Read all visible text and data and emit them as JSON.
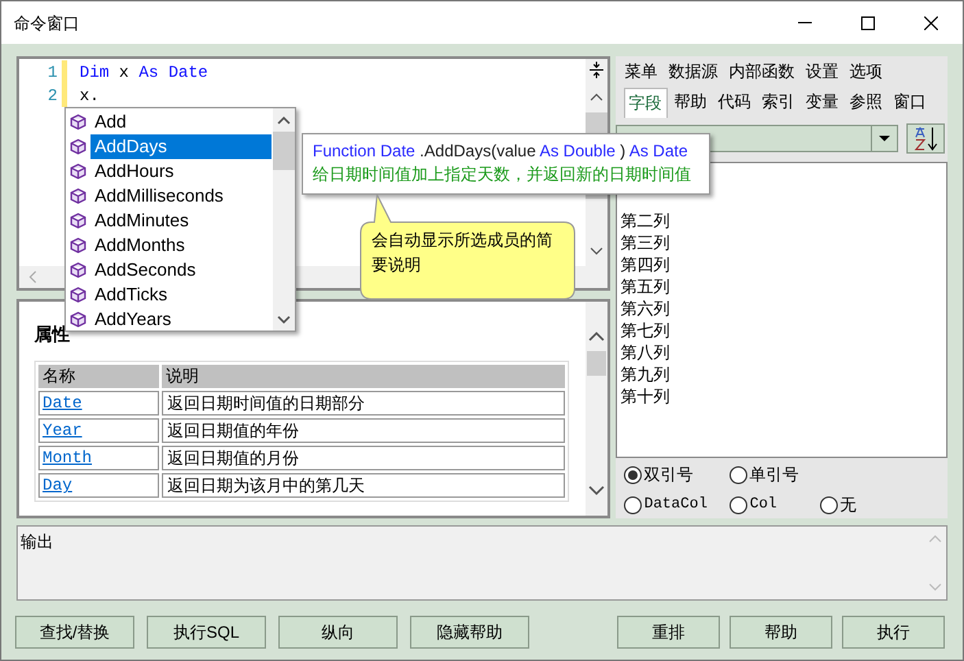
{
  "window": {
    "title": "命令窗口"
  },
  "editor": {
    "lines": [
      {
        "number": "1",
        "tokens": [
          {
            "text": "Dim",
            "kind": "keyword"
          },
          {
            "text": "x",
            "kind": "plain"
          },
          {
            "text": "As",
            "kind": "keyword"
          },
          {
            "text": "Date",
            "kind": "keyword"
          }
        ]
      },
      {
        "number": "2",
        "tokens": [
          {
            "text": "x.",
            "kind": "plain"
          }
        ]
      }
    ]
  },
  "autocomplete": {
    "items": [
      {
        "label": "Add",
        "selected": false
      },
      {
        "label": "AddDays",
        "selected": true
      },
      {
        "label": "AddHours",
        "selected": false
      },
      {
        "label": "AddMilliseconds",
        "selected": false
      },
      {
        "label": "AddMinutes",
        "selected": false
      },
      {
        "label": "AddMonths",
        "selected": false
      },
      {
        "label": "AddSeconds",
        "selected": false
      },
      {
        "label": "AddTicks",
        "selected": false
      },
      {
        "label": "AddYears",
        "selected": false
      }
    ]
  },
  "tooltip": {
    "signature": [
      {
        "text": "Function",
        "kind": "keyword"
      },
      {
        "text": "Date",
        "kind": "keyword"
      },
      {
        "text": ".AddDays(value",
        "kind": "plain"
      },
      {
        "text": "As Double",
        "kind": "keyword"
      },
      {
        "text": ")",
        "kind": "plain"
      },
      {
        "text": "As Date",
        "kind": "keyword"
      }
    ],
    "description": "给日期时间值加上指定天数，并返回新的日期时间值"
  },
  "callout": {
    "text": "会自动显示所选成员的简要说明"
  },
  "help": {
    "title": "属性",
    "columns": [
      "名称",
      "说明"
    ],
    "rows": [
      {
        "name": "Date",
        "description": "返回日期时间值的日期部分"
      },
      {
        "name": "Year",
        "description": "返回日期值的年份"
      },
      {
        "name": "Month",
        "description": "返回日期值的月份"
      },
      {
        "name": "Day",
        "description": "返回日期为该月中的第几天"
      }
    ]
  },
  "side_panel": {
    "menu": [
      "菜单",
      "数据源",
      "内部函数",
      "设置",
      "选项"
    ],
    "tabs": [
      {
        "label": "字段",
        "selected": true
      },
      {
        "label": "帮助",
        "selected": false
      },
      {
        "label": "代码",
        "selected": false
      },
      {
        "label": "索引",
        "selected": false
      },
      {
        "label": "变量",
        "selected": false
      },
      {
        "label": "参照",
        "selected": false
      },
      {
        "label": "窗口",
        "selected": false
      }
    ],
    "fields": [
      "第二列",
      "第三列",
      "第四列",
      "第五列",
      "第六列",
      "第七列",
      "第八列",
      "第九列",
      "第十列"
    ],
    "quote_options": [
      {
        "label": "双引号",
        "selected": true
      },
      {
        "label": "单引号",
        "selected": false
      },
      {
        "label": "DataCol",
        "selected": false
      },
      {
        "label": "Col",
        "selected": false
      },
      {
        "label": "无",
        "selected": false
      }
    ]
  },
  "output": {
    "label": "输出"
  },
  "buttons_left": [
    "查找/替换",
    "执行SQL",
    "纵向",
    "隐藏帮助"
  ],
  "buttons_right": [
    "重排",
    "帮助",
    "执行"
  ]
}
